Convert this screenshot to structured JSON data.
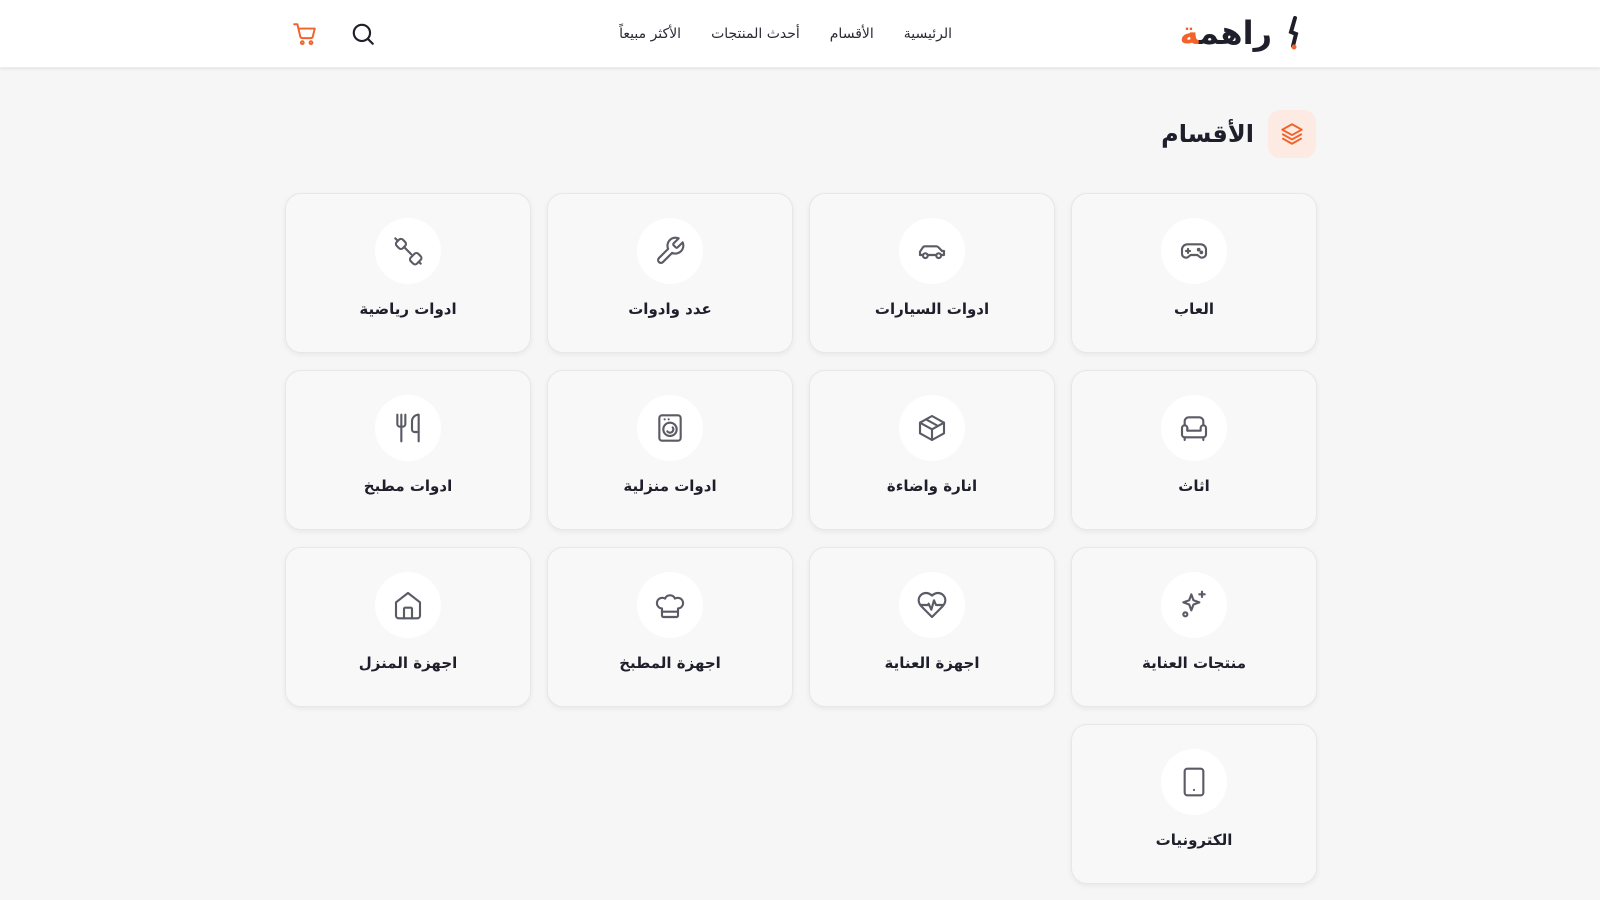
{
  "header": {
    "logo": {
      "text_main": "راهم",
      "text_accent": "ة"
    },
    "nav": [
      {
        "label": "الرئيسية"
      },
      {
        "label": "الأقسام"
      },
      {
        "label": "أحدث المنتجات"
      },
      {
        "label": "الأكثر مبيعاً"
      }
    ],
    "actions": {
      "search_icon": "search-icon",
      "cart_icon": "cart-icon"
    }
  },
  "section": {
    "title": "الأقسام",
    "icon": "layers-icon"
  },
  "categories": [
    {
      "label": "العاب",
      "icon": "gamepad-icon"
    },
    {
      "label": "ادوات السيارات",
      "icon": "car-icon"
    },
    {
      "label": "عدد وادوات",
      "icon": "wrench-icon"
    },
    {
      "label": "ادوات رياضية",
      "icon": "dumbbell-icon"
    },
    {
      "label": "اثاث",
      "icon": "sofa-icon"
    },
    {
      "label": "انارة واضاءة",
      "icon": "box-icon"
    },
    {
      "label": "ادوات منزلية",
      "icon": "washing-machine-icon"
    },
    {
      "label": "ادوات مطبخ",
      "icon": "utensils-icon"
    },
    {
      "label": "منتجات العناية",
      "icon": "sparkles-icon"
    },
    {
      "label": "اجهزة العناية",
      "icon": "heart-pulse-icon"
    },
    {
      "label": "اجهزة المطبخ",
      "icon": "chef-hat-icon"
    },
    {
      "label": "اجهزة المنزل",
      "icon": "home-icon"
    },
    {
      "label": "الكترونيات",
      "icon": "tablet-icon"
    }
  ],
  "colors": {
    "accent": "#f2632b",
    "icon": "#5b5b66",
    "text": "#1f1f2b"
  }
}
